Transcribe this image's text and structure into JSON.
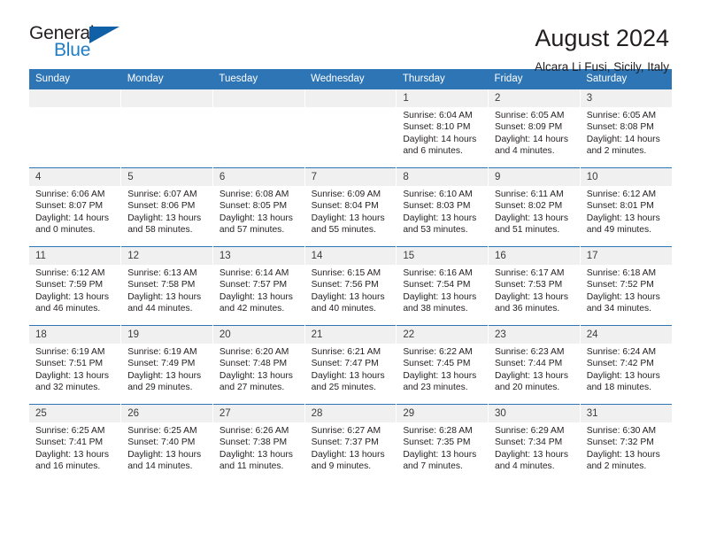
{
  "brand": {
    "name_top": "General",
    "name_bottom": "Blue",
    "triangle_color": "#1060a8",
    "blue_text_color": "#1f7dc4"
  },
  "header": {
    "title": "August 2024",
    "subtitle": "Alcara Li Fusi, Sicily, Italy"
  },
  "theme": {
    "header_row_bg": "#2e75b6",
    "day_band_bg": "#f0f0f0",
    "row_divider": "#2e75b6",
    "text": "#231f20"
  },
  "weekdays": [
    "Sunday",
    "Monday",
    "Tuesday",
    "Wednesday",
    "Thursday",
    "Friday",
    "Saturday"
  ],
  "labels": {
    "sunrise_prefix": "Sunrise:",
    "sunset_prefix": "Sunset:",
    "daylight_prefix": "Daylight:"
  },
  "weeks": [
    [
      {
        "blank": true,
        "day": ""
      },
      {
        "blank": true,
        "day": ""
      },
      {
        "blank": true,
        "day": ""
      },
      {
        "blank": true,
        "day": ""
      },
      {
        "day": "1",
        "sunrise": "Sunrise: 6:04 AM",
        "sunset": "Sunset: 8:10 PM",
        "daylight1": "Daylight: 14 hours",
        "daylight2": "and 6 minutes."
      },
      {
        "day": "2",
        "sunrise": "Sunrise: 6:05 AM",
        "sunset": "Sunset: 8:09 PM",
        "daylight1": "Daylight: 14 hours",
        "daylight2": "and 4 minutes."
      },
      {
        "day": "3",
        "sunrise": "Sunrise: 6:05 AM",
        "sunset": "Sunset: 8:08 PM",
        "daylight1": "Daylight: 14 hours",
        "daylight2": "and 2 minutes."
      }
    ],
    [
      {
        "day": "4",
        "sunrise": "Sunrise: 6:06 AM",
        "sunset": "Sunset: 8:07 PM",
        "daylight1": "Daylight: 14 hours",
        "daylight2": "and 0 minutes."
      },
      {
        "day": "5",
        "sunrise": "Sunrise: 6:07 AM",
        "sunset": "Sunset: 8:06 PM",
        "daylight1": "Daylight: 13 hours",
        "daylight2": "and 58 minutes."
      },
      {
        "day": "6",
        "sunrise": "Sunrise: 6:08 AM",
        "sunset": "Sunset: 8:05 PM",
        "daylight1": "Daylight: 13 hours",
        "daylight2": "and 57 minutes."
      },
      {
        "day": "7",
        "sunrise": "Sunrise: 6:09 AM",
        "sunset": "Sunset: 8:04 PM",
        "daylight1": "Daylight: 13 hours",
        "daylight2": "and 55 minutes."
      },
      {
        "day": "8",
        "sunrise": "Sunrise: 6:10 AM",
        "sunset": "Sunset: 8:03 PM",
        "daylight1": "Daylight: 13 hours",
        "daylight2": "and 53 minutes."
      },
      {
        "day": "9",
        "sunrise": "Sunrise: 6:11 AM",
        "sunset": "Sunset: 8:02 PM",
        "daylight1": "Daylight: 13 hours",
        "daylight2": "and 51 minutes."
      },
      {
        "day": "10",
        "sunrise": "Sunrise: 6:12 AM",
        "sunset": "Sunset: 8:01 PM",
        "daylight1": "Daylight: 13 hours",
        "daylight2": "and 49 minutes."
      }
    ],
    [
      {
        "day": "11",
        "sunrise": "Sunrise: 6:12 AM",
        "sunset": "Sunset: 7:59 PM",
        "daylight1": "Daylight: 13 hours",
        "daylight2": "and 46 minutes."
      },
      {
        "day": "12",
        "sunrise": "Sunrise: 6:13 AM",
        "sunset": "Sunset: 7:58 PM",
        "daylight1": "Daylight: 13 hours",
        "daylight2": "and 44 minutes."
      },
      {
        "day": "13",
        "sunrise": "Sunrise: 6:14 AM",
        "sunset": "Sunset: 7:57 PM",
        "daylight1": "Daylight: 13 hours",
        "daylight2": "and 42 minutes."
      },
      {
        "day": "14",
        "sunrise": "Sunrise: 6:15 AM",
        "sunset": "Sunset: 7:56 PM",
        "daylight1": "Daylight: 13 hours",
        "daylight2": "and 40 minutes."
      },
      {
        "day": "15",
        "sunrise": "Sunrise: 6:16 AM",
        "sunset": "Sunset: 7:54 PM",
        "daylight1": "Daylight: 13 hours",
        "daylight2": "and 38 minutes."
      },
      {
        "day": "16",
        "sunrise": "Sunrise: 6:17 AM",
        "sunset": "Sunset: 7:53 PM",
        "daylight1": "Daylight: 13 hours",
        "daylight2": "and 36 minutes."
      },
      {
        "day": "17",
        "sunrise": "Sunrise: 6:18 AM",
        "sunset": "Sunset: 7:52 PM",
        "daylight1": "Daylight: 13 hours",
        "daylight2": "and 34 minutes."
      }
    ],
    [
      {
        "day": "18",
        "sunrise": "Sunrise: 6:19 AM",
        "sunset": "Sunset: 7:51 PM",
        "daylight1": "Daylight: 13 hours",
        "daylight2": "and 32 minutes."
      },
      {
        "day": "19",
        "sunrise": "Sunrise: 6:19 AM",
        "sunset": "Sunset: 7:49 PM",
        "daylight1": "Daylight: 13 hours",
        "daylight2": "and 29 minutes."
      },
      {
        "day": "20",
        "sunrise": "Sunrise: 6:20 AM",
        "sunset": "Sunset: 7:48 PM",
        "daylight1": "Daylight: 13 hours",
        "daylight2": "and 27 minutes."
      },
      {
        "day": "21",
        "sunrise": "Sunrise: 6:21 AM",
        "sunset": "Sunset: 7:47 PM",
        "daylight1": "Daylight: 13 hours",
        "daylight2": "and 25 minutes."
      },
      {
        "day": "22",
        "sunrise": "Sunrise: 6:22 AM",
        "sunset": "Sunset: 7:45 PM",
        "daylight1": "Daylight: 13 hours",
        "daylight2": "and 23 minutes."
      },
      {
        "day": "23",
        "sunrise": "Sunrise: 6:23 AM",
        "sunset": "Sunset: 7:44 PM",
        "daylight1": "Daylight: 13 hours",
        "daylight2": "and 20 minutes."
      },
      {
        "day": "24",
        "sunrise": "Sunrise: 6:24 AM",
        "sunset": "Sunset: 7:42 PM",
        "daylight1": "Daylight: 13 hours",
        "daylight2": "and 18 minutes."
      }
    ],
    [
      {
        "day": "25",
        "sunrise": "Sunrise: 6:25 AM",
        "sunset": "Sunset: 7:41 PM",
        "daylight1": "Daylight: 13 hours",
        "daylight2": "and 16 minutes."
      },
      {
        "day": "26",
        "sunrise": "Sunrise: 6:25 AM",
        "sunset": "Sunset: 7:40 PM",
        "daylight1": "Daylight: 13 hours",
        "daylight2": "and 14 minutes."
      },
      {
        "day": "27",
        "sunrise": "Sunrise: 6:26 AM",
        "sunset": "Sunset: 7:38 PM",
        "daylight1": "Daylight: 13 hours",
        "daylight2": "and 11 minutes."
      },
      {
        "day": "28",
        "sunrise": "Sunrise: 6:27 AM",
        "sunset": "Sunset: 7:37 PM",
        "daylight1": "Daylight: 13 hours",
        "daylight2": "and 9 minutes."
      },
      {
        "day": "29",
        "sunrise": "Sunrise: 6:28 AM",
        "sunset": "Sunset: 7:35 PM",
        "daylight1": "Daylight: 13 hours",
        "daylight2": "and 7 minutes."
      },
      {
        "day": "30",
        "sunrise": "Sunrise: 6:29 AM",
        "sunset": "Sunset: 7:34 PM",
        "daylight1": "Daylight: 13 hours",
        "daylight2": "and 4 minutes."
      },
      {
        "day": "31",
        "sunrise": "Sunrise: 6:30 AM",
        "sunset": "Sunset: 7:32 PM",
        "daylight1": "Daylight: 13 hours",
        "daylight2": "and 2 minutes."
      }
    ]
  ]
}
